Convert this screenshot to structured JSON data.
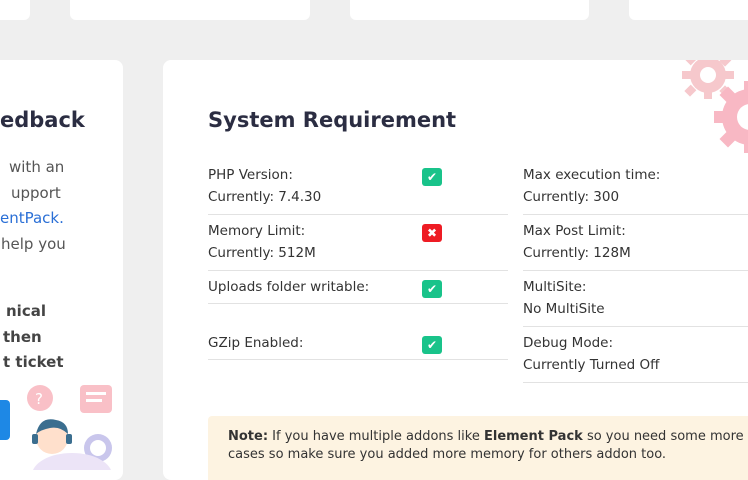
{
  "left_panel": {
    "title": "edback",
    "lines": [
      "with an",
      "upport"
    ],
    "link_line": "entPack.",
    "line_after": "help you",
    "bold_lines": [
      "nical",
      "then",
      "t ticket"
    ]
  },
  "system": {
    "title": "System Requirement",
    "left_items": [
      {
        "label": "PHP Version:",
        "value": "Currently: 7.4.30",
        "status": "ok"
      },
      {
        "label": "Memory Limit:",
        "value": "Currently: 512M",
        "status": "bad"
      },
      {
        "label": "Uploads folder writable:",
        "value": "",
        "status": "ok"
      },
      {
        "label": "GZip Enabled:",
        "value": "",
        "status": "ok"
      }
    ],
    "right_items": [
      {
        "label": "Max execution time:",
        "value": "Currently: 300",
        "status": "ok"
      },
      {
        "label": "Max Post Limit:",
        "value": "Currently: 128M",
        "status": "ok"
      },
      {
        "label": "MultiSite:",
        "value": "No MultiSite",
        "status": "ok"
      },
      {
        "label": "Debug Mode:",
        "value": "Currently Turned Off",
        "status": "ok"
      }
    ],
    "note": {
      "label": "Note:",
      "text_a": " If you have multiple addons like ",
      "brand": "Element Pack",
      "text_b": " so you need some more requirement",
      "line2": "cases so make sure you added more memory for others addon too."
    }
  },
  "colors": {
    "ok": "#19c38a",
    "bad": "#ee1c24",
    "link": "#2a6fd6",
    "note_bg": "#fdf3e1"
  },
  "icons": {
    "ok": "✔",
    "bad": "✖"
  }
}
